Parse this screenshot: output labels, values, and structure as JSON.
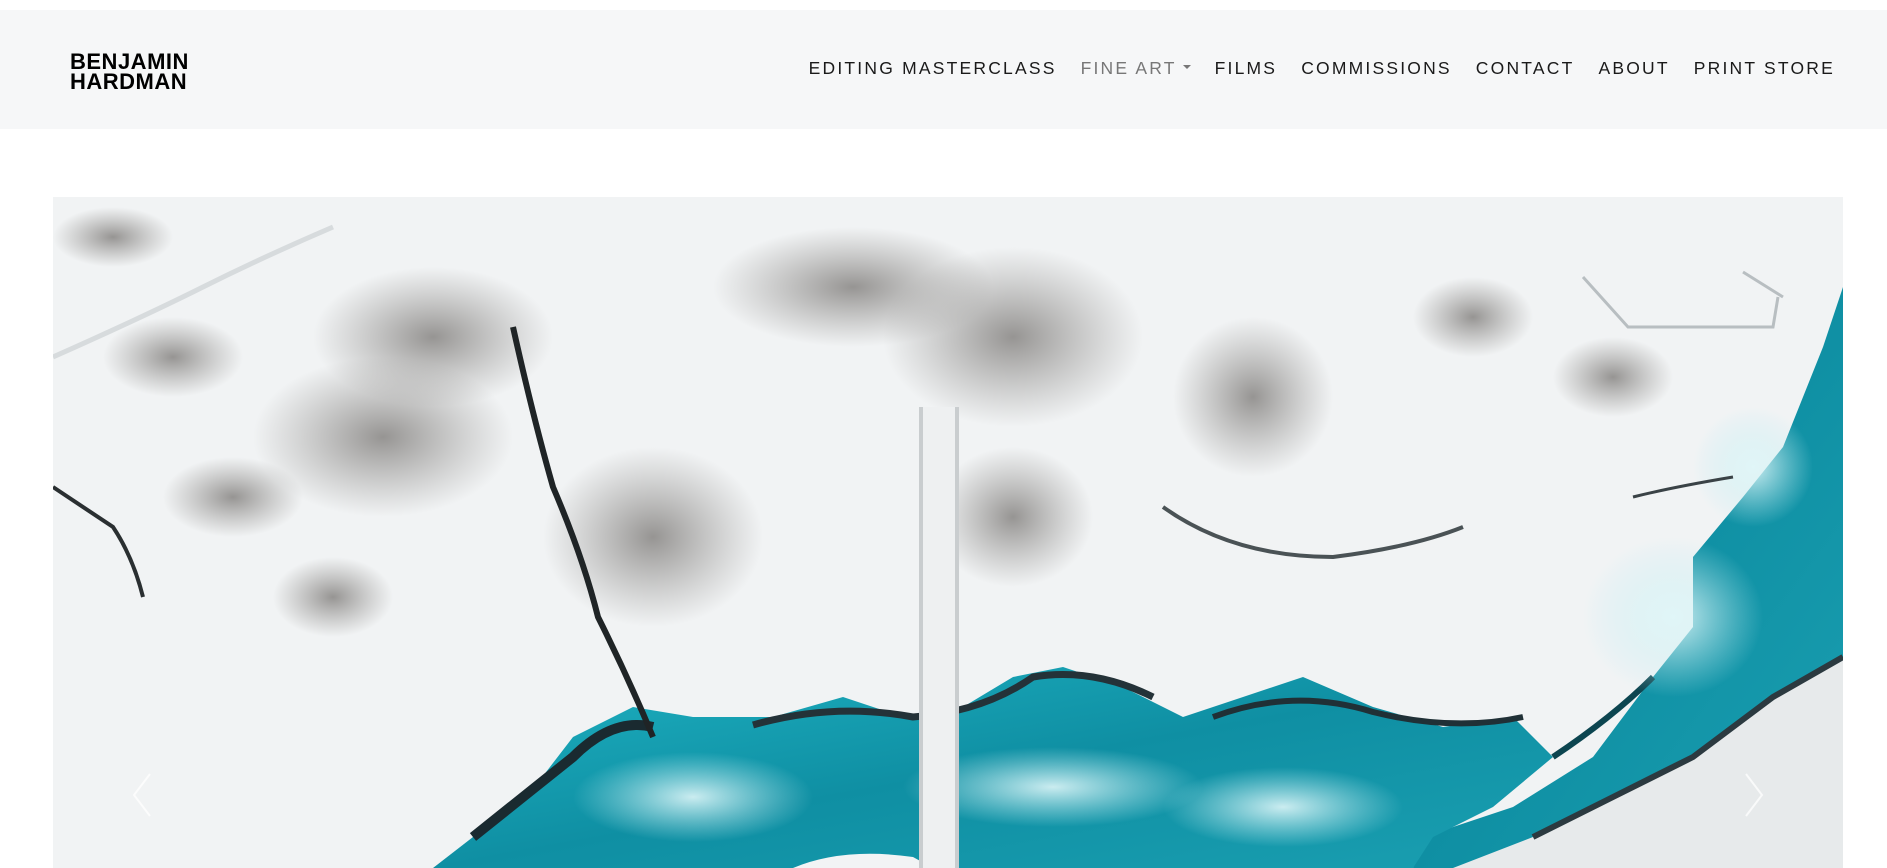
{
  "brand": {
    "line1": "BENJAMIN",
    "line2": "HARDMAN"
  },
  "nav": {
    "items": [
      {
        "label": "EDITING MASTERCLASS",
        "active": false
      },
      {
        "label": "FINE ART",
        "active": true,
        "dropdown": true
      },
      {
        "label": "FILMS",
        "active": false
      },
      {
        "label": "COMMISSIONS",
        "active": false
      },
      {
        "label": "CONTACT",
        "active": false
      },
      {
        "label": "ABOUT",
        "active": false
      },
      {
        "label": "PRINT STORE",
        "active": false
      }
    ],
    "caret_icon": "caret-down-icon"
  },
  "hero": {
    "image_subject": "aerial-winter-river-photo",
    "prev_icon": "chevron-left-icon",
    "next_icon": "chevron-right-icon"
  },
  "colors": {
    "header_bg": "#f6f7f8",
    "nav_text": "#1a1a1a",
    "nav_active": "#777777",
    "water": "#16a3b5",
    "snow": "#f2f4f5"
  }
}
